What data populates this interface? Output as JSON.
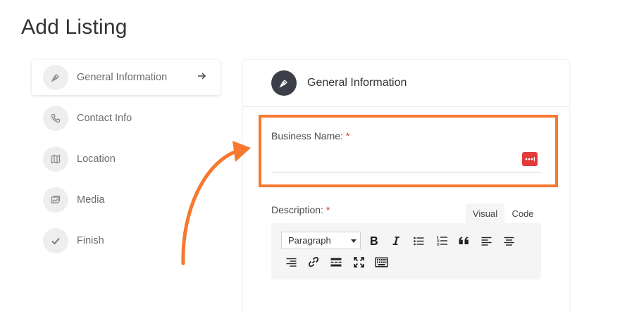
{
  "page": {
    "title": "Add Listing"
  },
  "steps": [
    {
      "label": "General Information",
      "icon": "pen-nib-icon",
      "active": true
    },
    {
      "label": "Contact Info",
      "icon": "phone-icon",
      "active": false
    },
    {
      "label": "Location",
      "icon": "map-icon",
      "active": false
    },
    {
      "label": "Media",
      "icon": "images-icon",
      "active": false
    },
    {
      "label": "Finish",
      "icon": "check-icon",
      "active": false
    }
  ],
  "card": {
    "title": "General Information",
    "icon": "pen-nib-icon"
  },
  "business_name": {
    "label": "Business Name:",
    "required_mark": "*",
    "value": ""
  },
  "description": {
    "label": "Description:",
    "required_mark": "*"
  },
  "editor": {
    "tabs": {
      "visual": "Visual",
      "code": "Code",
      "active": "visual"
    },
    "format_select": "Paragraph",
    "toolbar": [
      "bold-icon",
      "italic-icon",
      "bullet-list-icon",
      "numbered-list-icon",
      "blockquote-icon",
      "align-left-icon",
      "align-center-icon",
      "align-right-icon",
      "link-icon",
      "read-more-icon",
      "fullscreen-icon",
      "toolbar-toggle-icon"
    ]
  },
  "colors": {
    "highlight": "#f7782f",
    "required": "#d9302a",
    "password_badge": "#e23b3b",
    "header_icon_bg": "#3c3f4a"
  }
}
